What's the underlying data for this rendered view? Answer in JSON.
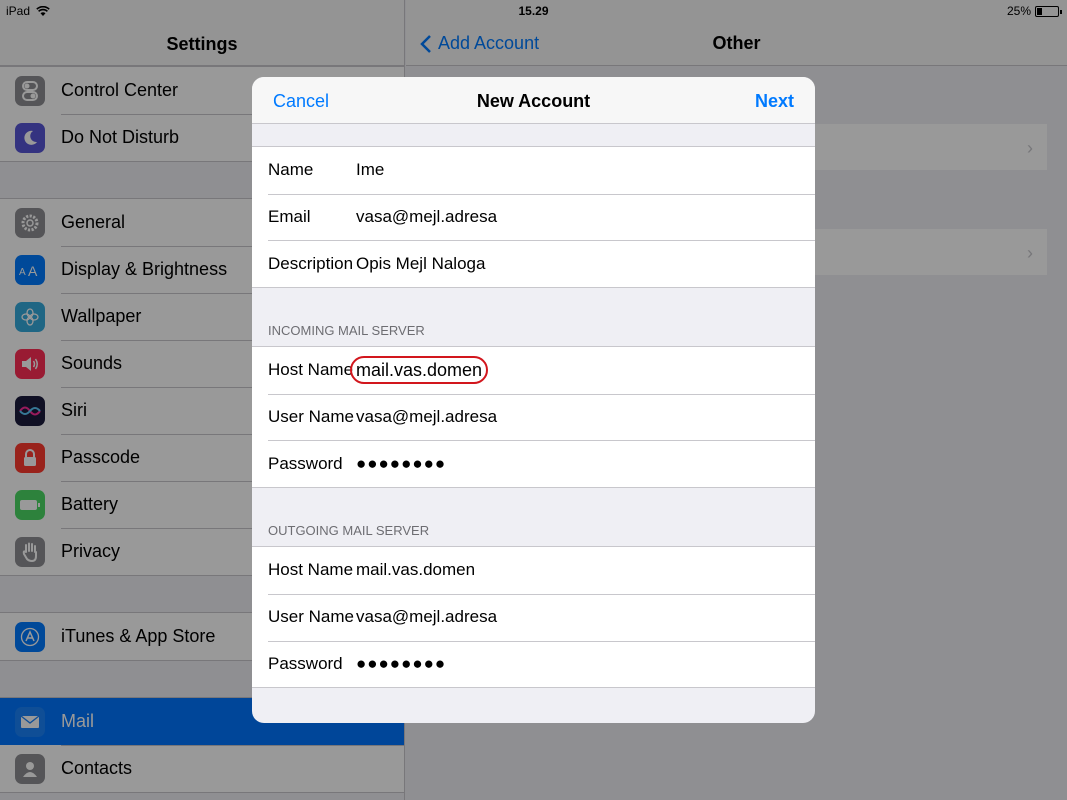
{
  "status": {
    "device": "iPad",
    "time": "15.29",
    "battery": "25%",
    "battery_level": 0.25
  },
  "sidebar": {
    "title": "Settings",
    "groups": [
      [
        {
          "label": "Control Center",
          "icon": "control-center-icon",
          "color": "#8e8e93"
        },
        {
          "label": "Do Not Disturb",
          "icon": "moon-icon",
          "color": "#5856d6"
        }
      ],
      [
        {
          "label": "General",
          "icon": "gear-icon",
          "color": "#8e8e93"
        },
        {
          "label": "Display & Brightness",
          "icon": "display-brightness-icon",
          "color": "#007aff"
        },
        {
          "label": "Wallpaper",
          "icon": "wallpaper-icon",
          "color": "#34aadc"
        },
        {
          "label": "Sounds",
          "icon": "speaker-icon",
          "color": "#ff2d55"
        },
        {
          "label": "Siri",
          "icon": "siri-icon",
          "color": "#1c1c3c"
        },
        {
          "label": "Passcode",
          "icon": "lock-icon",
          "color": "#ff3b30"
        },
        {
          "label": "Battery",
          "icon": "battery-icon",
          "color": "#4cd964"
        },
        {
          "label": "Privacy",
          "icon": "hand-icon",
          "color": "#8e8e93"
        }
      ],
      [
        {
          "label": "iTunes & App Store",
          "icon": "app-store-icon",
          "color": "#007aff"
        }
      ],
      [
        {
          "label": "Mail",
          "icon": "mail-icon",
          "color": "#1a82fb",
          "selected": true
        },
        {
          "label": "Contacts",
          "icon": "contacts-icon",
          "color": "#8e8e93"
        }
      ]
    ]
  },
  "detail": {
    "back_label": "Add Account",
    "title": "Other"
  },
  "modal": {
    "cancel": "Cancel",
    "title": "New Account",
    "next": "Next",
    "account": {
      "name_label": "Name",
      "name_value": "Ime",
      "email_label": "Email",
      "email_value": "vasa@mejl.adresa",
      "description_label": "Description",
      "description_value": "Opis Mejl Naloga"
    },
    "incoming": {
      "header": "INCOMING MAIL SERVER",
      "host_label": "Host Name",
      "host_value": "mail.vas.domen",
      "user_label": "User Name",
      "user_value": "vasa@mejl.adresa",
      "password_label": "Password",
      "password_value": "●●●●●●●●"
    },
    "outgoing": {
      "header": "OUTGOING MAIL SERVER",
      "host_label": "Host Name",
      "host_value": "mail.vas.domen",
      "user_label": "User Name",
      "user_value": "vasa@mejl.adresa",
      "password_label": "Password",
      "password_value": "●●●●●●●●"
    }
  }
}
